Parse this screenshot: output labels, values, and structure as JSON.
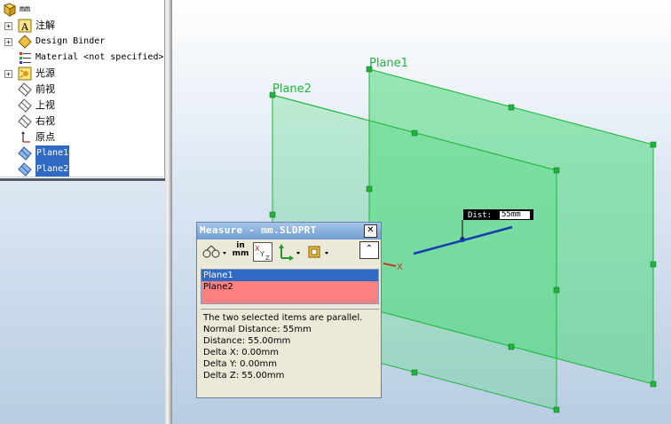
{
  "tree": {
    "root": "mm",
    "items": [
      {
        "label": "注解",
        "icon": "annotations-icon",
        "expandable": true,
        "mono": false,
        "selected": false
      },
      {
        "label": "Design Binder",
        "icon": "design-binder-icon",
        "expandable": true,
        "mono": true,
        "selected": false
      },
      {
        "label": "Material <not specified>",
        "icon": "material-icon",
        "expandable": false,
        "mono": true,
        "selected": false
      },
      {
        "label": "光源",
        "icon": "lights-icon",
        "expandable": true,
        "mono": false,
        "selected": false
      },
      {
        "label": "前视",
        "icon": "plane-icon",
        "expandable": false,
        "mono": false,
        "selected": false
      },
      {
        "label": "上视",
        "icon": "plane-icon",
        "expandable": false,
        "mono": false,
        "selected": false
      },
      {
        "label": "右视",
        "icon": "plane-icon",
        "expandable": false,
        "mono": false,
        "selected": false
      },
      {
        "label": "原点",
        "icon": "origin-icon",
        "expandable": false,
        "mono": false,
        "selected": false
      },
      {
        "label": "Plane1",
        "icon": "plane-icon",
        "expandable": false,
        "mono": true,
        "selected": true
      },
      {
        "label": "Plane2",
        "icon": "plane-icon",
        "expandable": false,
        "mono": true,
        "selected": true
      }
    ]
  },
  "viewport": {
    "plane1_label": "Plane1",
    "plane2_label": "Plane2",
    "dimension": {
      "label": "Dist:",
      "value": "55mm"
    },
    "axis_label": "X",
    "plane_color": "#4dd97a",
    "edge_color": "#1fb53a"
  },
  "measure": {
    "title": "Measure - mm.SLDPRT",
    "close_symbol": "✕",
    "collapse_symbol": "⌃",
    "units_top": "in",
    "units_bottom": "mm",
    "selections": [
      {
        "label": "Plane1",
        "highlighted": true
      },
      {
        "label": "Plane2",
        "highlighted": false
      }
    ],
    "results": [
      "The two selected items are parallel.",
      "Normal Distance: 55mm",
      "Distance: 55.00mm",
      "Delta X: 0.00mm",
      "Delta Y: 0.00mm",
      "Delta Z: 55.00mm"
    ]
  }
}
